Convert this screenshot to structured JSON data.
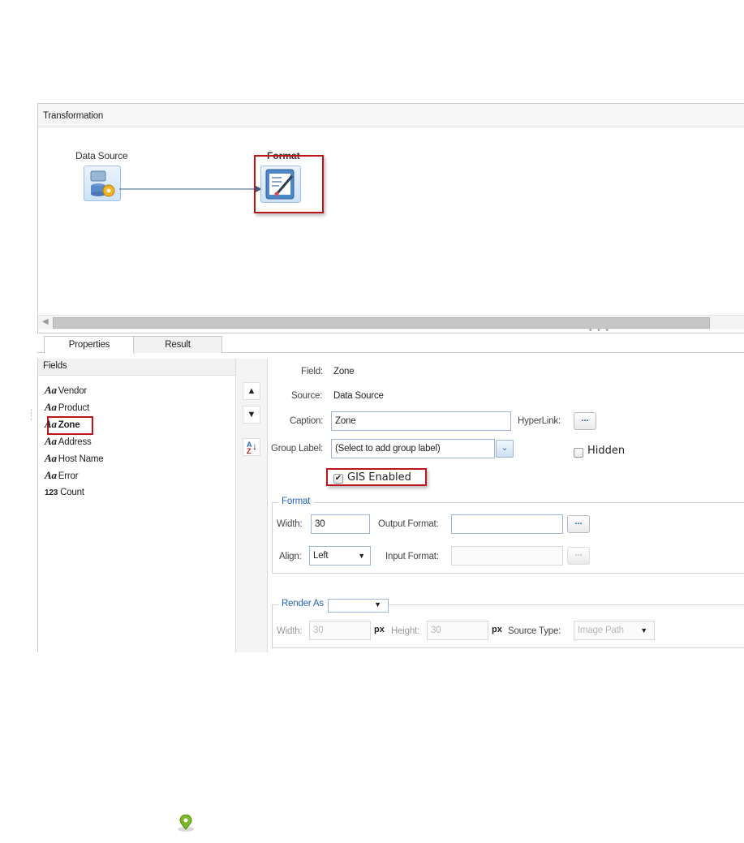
{
  "transformation": {
    "title": "Transformation",
    "nodes": [
      {
        "label": "Data Source",
        "icon": "database-gear-icon"
      },
      {
        "label": "Format",
        "icon": "format-brush-icon"
      }
    ]
  },
  "tabs": [
    {
      "label": "Properties",
      "active": true
    },
    {
      "label": "Result",
      "active": false
    }
  ],
  "fields_panel": {
    "header": "Fields",
    "items": [
      {
        "icon_text": "Aa",
        "label": "Vendor"
      },
      {
        "icon_text": "Aa",
        "label": "Product"
      },
      {
        "icon_text": "Aa",
        "label": "Zone",
        "selected": true
      },
      {
        "icon_text": "Aa",
        "label": "Address"
      },
      {
        "icon_text": "Aa",
        "label": "Host Name"
      },
      {
        "icon_text": "Aa",
        "label": "Error"
      },
      {
        "icon_text": "123",
        "label": "Count"
      }
    ]
  },
  "sort_buttons": {
    "up": "▲",
    "down": "▼",
    "az_top": "A",
    "az_bottom": "Z",
    "az_arrow": "↓"
  },
  "properties": {
    "field_label": "Field:",
    "field_value": "Zone",
    "source_label": "Source:",
    "source_value": "Data Source",
    "caption_label": "Caption:",
    "caption_value": "Zone",
    "hyperlink_label": "HyperLink:",
    "ellipsis": "...",
    "group_label_label": "Group Label:",
    "group_label_value": "(Select to add group label)",
    "hidden_label": "Hidden",
    "gis_label": "GIS Enabled",
    "gis_checked": true
  },
  "format_group": {
    "legend": "Format",
    "width_label": "Width:",
    "width_value": "30",
    "output_format_label": "Output Format:",
    "output_format_value": "",
    "align_label": "Align:",
    "align_value": "Left",
    "input_format_label": "Input Format:",
    "input_format_value": ""
  },
  "render_group": {
    "legend": "Render As",
    "render_value": "",
    "width_label": "Width:",
    "width_value": "30",
    "px1": "px",
    "height_label": "Height:",
    "height_value": "30",
    "px2": "px",
    "source_type_label": "Source Type:",
    "source_type_value": "Image Path"
  },
  "colors": {
    "highlight": "#c0141b",
    "legend": "#2563b0",
    "map_pin": "#7ab829"
  },
  "footer_icon": "map-pin-icon"
}
